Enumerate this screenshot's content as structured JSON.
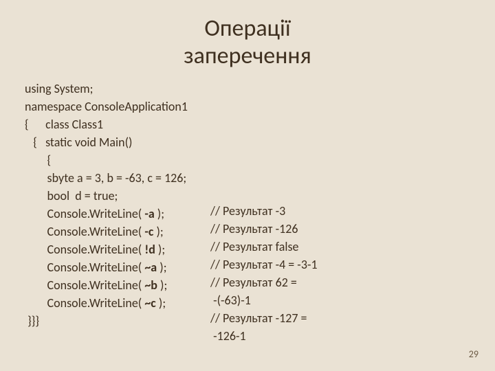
{
  "title_line1": "Операції",
  "title_line2": "заперечення",
  "code": {
    "l1": "using System;",
    "l2": "namespace ConsoleApplication1",
    "l3": "{      class Class1",
    "l4": "   {   static void Main()",
    "l5": "        {",
    "l6": "        sbyte a = 3, b = -63, c = 126;",
    "l7": "        bool  d = true;",
    "l8a": "        Console.WriteLine( ",
    "l8b": "-a",
    "l8c": " );",
    "l9a": "        Console.WriteLine( ",
    "l9b": "-c",
    "l9c": " );",
    "l10a": "        Console.WriteLine( ",
    "l10b": "!d",
    "l10c": " );",
    "l11a": "        Console.WriteLine( ",
    "l11b": "~a",
    "l11c": " );",
    "l12a": "        Console.WriteLine( ",
    "l12b": "~b",
    "l12c": " );",
    "l13a": "        Console.WriteLine( ",
    "l13b": "~c",
    "l13c": " );",
    "l14": " }}}"
  },
  "comments": {
    "c1": "// Результат -3",
    "c2": "// Результат -126",
    "c3": "// Результат false",
    "c4": "// Результат -4 = -3-1",
    "c5a": "// Результат 62 =",
    "c5b": " -(-63)-1",
    "c6a": "// Результат -127 =",
    "c6b": " -126-1"
  },
  "pagenum": "29"
}
